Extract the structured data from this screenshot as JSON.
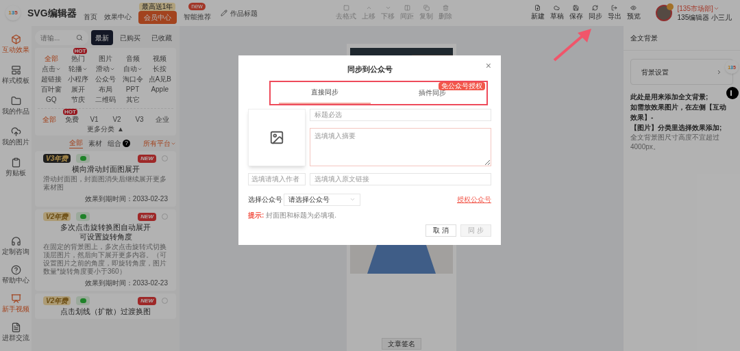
{
  "topbar": {
    "logo": "135",
    "title": "SVG编辑器",
    "nav": [
      {
        "label": "首页",
        "kind": "link"
      },
      {
        "label": "效果中心",
        "kind": "link"
      },
      {
        "label": "会员中心",
        "kind": "member",
        "badge": "最高送1年"
      },
      {
        "label": "智能推荐",
        "kind": "link",
        "badge": "new"
      }
    ],
    "doc_title": "作品标题",
    "tools": [
      {
        "label": "去格式",
        "disabled": true
      },
      {
        "label": "上移",
        "disabled": true
      },
      {
        "label": "下移",
        "disabled": true
      },
      {
        "label": "间距",
        "disabled": true
      },
      {
        "label": "复制",
        "disabled": true
      },
      {
        "label": "删除",
        "disabled": true
      }
    ],
    "actions": [
      {
        "label": "新建"
      },
      {
        "label": "草稿"
      },
      {
        "label": "保存"
      },
      {
        "label": "同步"
      },
      {
        "label": "导出"
      },
      {
        "label": "预览"
      }
    ],
    "user": {
      "team": "[135市场部]",
      "name": "135编辑器 小三儿"
    }
  },
  "sidebar": {
    "items": [
      {
        "label": "互动效果",
        "selected": true
      },
      {
        "label": "样式模板",
        "selected": false
      },
      {
        "label": "我的作品",
        "selected": false
      },
      {
        "label": "我的图片",
        "selected": false
      },
      {
        "label": "剪贴板",
        "selected": false
      }
    ],
    "bottom_items": [
      {
        "label": "定制咨询",
        "selected": false
      },
      {
        "label": "帮助中心",
        "selected": false
      },
      {
        "label": "新手视频",
        "selected": true
      },
      {
        "label": "进群交流",
        "selected": false
      }
    ]
  },
  "panel": {
    "search": {
      "placeholder": "请输..."
    },
    "tabs": [
      {
        "label": "最新",
        "selected": true
      },
      {
        "label": "已购买",
        "selected": false
      },
      {
        "label": "已收藏",
        "selected": false
      }
    ],
    "categories": [
      {
        "label": "全部",
        "selected": true
      },
      {
        "label": "热门",
        "selected": false,
        "badge": "HOT"
      },
      {
        "label": "图片",
        "selected": false
      },
      {
        "label": "音频",
        "selected": false
      },
      {
        "label": "视频",
        "selected": false
      },
      {
        "label": "点击",
        "selected": false,
        "dropdown": true
      },
      {
        "label": "轮播",
        "selected": false,
        "dropdown": true
      },
      {
        "label": "滑动",
        "selected": false,
        "dropdown": true
      },
      {
        "label": "自动",
        "selected": false,
        "dropdown": true
      },
      {
        "label": "长按",
        "selected": false
      },
      {
        "label": "超链接",
        "selected": false
      },
      {
        "label": "小程序",
        "selected": false
      },
      {
        "label": "公众号",
        "selected": false
      },
      {
        "label": "淘口令",
        "selected": false
      },
      {
        "label": "点A见B",
        "selected": false
      },
      {
        "label": "百叶窗",
        "selected": false
      },
      {
        "label": "展开",
        "selected": false
      },
      {
        "label": "布局",
        "selected": false
      },
      {
        "label": "PPT",
        "selected": false
      },
      {
        "label": "Apple",
        "selected": false
      },
      {
        "label": "GQ",
        "selected": false
      },
      {
        "label": "节庆",
        "selected": false
      },
      {
        "label": "二维码",
        "selected": false
      },
      {
        "label": "其它",
        "selected": false
      }
    ],
    "levels": [
      {
        "label": "全部",
        "selected": true
      },
      {
        "label": "免费",
        "selected": false,
        "badge": "HOT"
      },
      {
        "label": "V1",
        "selected": false
      },
      {
        "label": "V2",
        "selected": false
      },
      {
        "label": "V3",
        "selected": false
      },
      {
        "label": "企业",
        "selected": false
      }
    ],
    "more": "更多分类",
    "more_icon": "▲",
    "subtabs": [
      {
        "label": "全部",
        "selected": true
      },
      {
        "label": "素材",
        "selected": false
      },
      {
        "label": "组合",
        "selected": false,
        "help": "?"
      }
    ],
    "platform": "所有平台",
    "cards": [
      {
        "tier": "V3年费",
        "kind": "v3",
        "new": "NEW",
        "title_lines": [
          "横向滑动封面图展开"
        ],
        "desc": "滑动封面图，封面图消失后继续展开更多素材图",
        "expiry": "效果到期时间：2033-02-23"
      },
      {
        "tier": "V2年费",
        "kind": "v2",
        "new": "NEW",
        "title_lines": [
          "多次点击旋转换图自动展开",
          "可设置旋转角度"
        ],
        "desc": "在固定的背景图上，多次点击旋转式切换顶层图片，然后向下展开更多内容。（可设置图片之前的角度，即旋转角度，图片数量*旋转角度要小于360）",
        "expiry": "效果到期时间：2033-02-23"
      },
      {
        "tier": "V2年费",
        "kind": "v2",
        "new": "NEW",
        "title_lines": [
          "点击划线（扩散）过渡换图"
        ]
      }
    ]
  },
  "canvas": {
    "signature": "文章签名"
  },
  "right_panel": {
    "title": "全文背景",
    "setting": "背景设置",
    "notes": [
      "此处是用来添加全文背景;",
      "如需放效果图片，在左侧【互动效果】-",
      "【图片】分类里选择效果添加;"
    ],
    "hint": "全文背景图尺寸高度不宜超过4000px。"
  },
  "float_logo": "135",
  "dialog": {
    "title": "同步到公众号",
    "close": "×",
    "tabs": [
      {
        "label": "直接同步",
        "selected": true
      },
      {
        "label": "插件同步",
        "selected": false,
        "badge": "免公众号授权"
      }
    ],
    "fields": {
      "title": {
        "placeholder": "标题必选"
      },
      "summary": {
        "placeholder": "选填填入摘要"
      },
      "author": {
        "placeholder": "选填请填入作者"
      },
      "link": {
        "placeholder": "选填填入原文链接"
      }
    },
    "account_label": "选择公众号",
    "account_select": "请选择公众号",
    "authorize": "授权公众号",
    "hint_label": "提示:",
    "hint": "封面图和标题为必填项.",
    "buttons": [
      {
        "label": "取 消",
        "disabled": false
      },
      {
        "label": "同 步",
        "disabled": true
      }
    ]
  }
}
